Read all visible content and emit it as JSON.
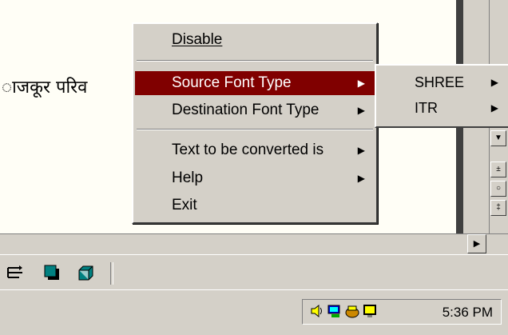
{
  "document": {
    "text": "ाजकूर परिव"
  },
  "context_menu": {
    "items": [
      {
        "label": "Disable",
        "mnemonic": "D",
        "has_submenu": false
      },
      {
        "label": "Source Font Type",
        "mnemonic": "S",
        "has_submenu": true,
        "highlighted": true
      },
      {
        "label": "Destination Font Type",
        "mnemonic": "s",
        "has_submenu": true
      },
      {
        "label": "Text to be converted is",
        "mnemonic": "",
        "has_submenu": true
      },
      {
        "label": "Help",
        "mnemonic": "H",
        "has_submenu": true
      },
      {
        "label": "Exit",
        "mnemonic": "x",
        "has_submenu": false
      }
    ]
  },
  "submenu": {
    "items": [
      {
        "label": "SHREE",
        "has_submenu": true
      },
      {
        "label": "ITR",
        "has_submenu": true
      }
    ]
  },
  "scrollbar": {
    "buttons": [
      "down-arrow",
      "plus-icon",
      "circle-icon",
      "minus-icon"
    ]
  },
  "toolbar": {
    "icons": [
      "outline-icon",
      "teal-square-icon",
      "3d-box-icon"
    ]
  },
  "taskbar": {
    "tray_icons": [
      "speaker-icon",
      "network-icon",
      "phone-icon",
      "monitor-icon"
    ],
    "clock": "5:36 PM"
  },
  "colors": {
    "highlight": "#800000",
    "face": "#d4d0c8",
    "document_bg": "#fffef6"
  }
}
